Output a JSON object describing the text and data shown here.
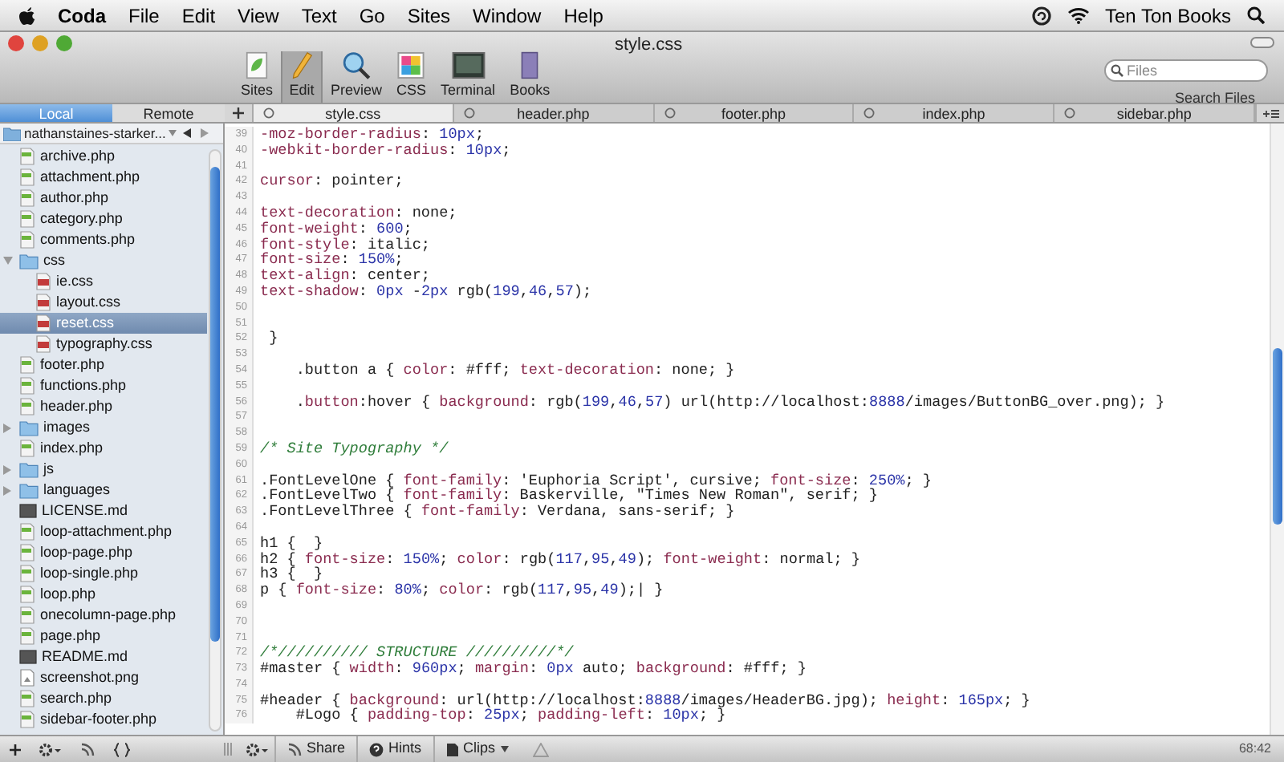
{
  "menu_bar": {
    "app": "Coda",
    "items": [
      "File",
      "Edit",
      "View",
      "Text",
      "Go",
      "Sites",
      "Window",
      "Help"
    ],
    "user": "Ten Ton Books"
  },
  "window": {
    "title": "style.css"
  },
  "toolbar": {
    "buttons": [
      {
        "label": "Sites",
        "kind": "sites",
        "selected": false
      },
      {
        "label": "Edit",
        "kind": "edit",
        "selected": true
      },
      {
        "label": "Preview",
        "kind": "preview",
        "selected": false
      },
      {
        "label": "CSS",
        "kind": "css",
        "selected": false
      },
      {
        "label": "Terminal",
        "kind": "terminal",
        "selected": false
      },
      {
        "label": "Books",
        "kind": "books",
        "selected": false
      }
    ],
    "search": {
      "placeholder": "Files",
      "label": "Search Files"
    }
  },
  "sidebar": {
    "tabs": [
      {
        "label": "Local",
        "selected": true
      },
      {
        "label": "Remote",
        "selected": false
      }
    ],
    "site": "nathanstaines-starker...",
    "items": [
      {
        "name": "archive.php",
        "kind": "php",
        "selected": false
      },
      {
        "name": "attachment.php",
        "kind": "php",
        "selected": false
      },
      {
        "name": "author.php",
        "kind": "php",
        "selected": false
      },
      {
        "name": "category.php",
        "kind": "php",
        "selected": false
      },
      {
        "name": "comments.php",
        "kind": "php",
        "selected": false
      },
      {
        "name": "css",
        "kind": "folder",
        "expanded": true,
        "selected": false,
        "children": [
          {
            "name": "ie.css",
            "kind": "css",
            "selected": false
          },
          {
            "name": "layout.css",
            "kind": "css",
            "selected": false
          },
          {
            "name": "reset.css",
            "kind": "css",
            "selected": true
          },
          {
            "name": "typography.css",
            "kind": "css",
            "selected": false
          }
        ]
      },
      {
        "name": "footer.php",
        "kind": "php",
        "selected": false
      },
      {
        "name": "functions.php",
        "kind": "php",
        "selected": false
      },
      {
        "name": "header.php",
        "kind": "php",
        "selected": false
      },
      {
        "name": "images",
        "kind": "folder",
        "expanded": false,
        "selected": false
      },
      {
        "name": "index.php",
        "kind": "php",
        "selected": false
      },
      {
        "name": "js",
        "kind": "folder",
        "expanded": false,
        "selected": false
      },
      {
        "name": "languages",
        "kind": "folder",
        "expanded": false,
        "selected": false
      },
      {
        "name": "LICENSE.md",
        "kind": "md",
        "selected": false
      },
      {
        "name": "loop-attachment.php",
        "kind": "php",
        "selected": false
      },
      {
        "name": "loop-page.php",
        "kind": "php",
        "selected": false
      },
      {
        "name": "loop-single.php",
        "kind": "php",
        "selected": false
      },
      {
        "name": "loop.php",
        "kind": "php",
        "selected": false
      },
      {
        "name": "onecolumn-page.php",
        "kind": "php",
        "selected": false
      },
      {
        "name": "page.php",
        "kind": "php",
        "selected": false
      },
      {
        "name": "README.md",
        "kind": "md",
        "selected": false
      },
      {
        "name": "screenshot.png",
        "kind": "png",
        "selected": false
      },
      {
        "name": "search.php",
        "kind": "php",
        "selected": false
      },
      {
        "name": "sidebar-footer.php",
        "kind": "php",
        "selected": false
      }
    ]
  },
  "tabs": [
    {
      "label": "style.css",
      "selected": true
    },
    {
      "label": "header.php",
      "selected": false
    },
    {
      "label": "footer.php",
      "selected": false
    },
    {
      "label": "index.php",
      "selected": false
    },
    {
      "label": "sidebar.php",
      "selected": false
    }
  ],
  "editor": {
    "lines": [
      {
        "num": "39",
        "text": "-moz-border-radius: 10px;"
      },
      {
        "num": "40",
        "text": "-webkit-border-radius: 10px;"
      },
      {
        "num": "41"
      },
      {
        "num": "42",
        "text": "cursor: pointer;"
      },
      {
        "num": "43"
      },
      {
        "num": "44",
        "text": "text-decoration: none;"
      },
      {
        "num": "45",
        "text": "font-weight: 600;"
      },
      {
        "num": "46",
        "text": "font-style: italic;"
      },
      {
        "num": "47",
        "text": "font-size: 150%;"
      },
      {
        "num": "48",
        "text": "text-align: center;"
      },
      {
        "num": "49",
        "text": "text-shadow: 0px -2px rgb(199,46,57);"
      },
      {
        "num": "50"
      },
      {
        "num": "51"
      },
      {
        "num": "52",
        "text": " }"
      },
      {
        "num": "53"
      },
      {
        "num": "54",
        "text": "    .button a { color: #fff; text-decoration: none; }"
      },
      {
        "num": "55"
      },
      {
        "num": "56",
        "text": "    .button:hover { background: rgb(199,46,57) url(http://localhost:8888/images/ButtonBG_over.png); }"
      },
      {
        "num": "57"
      },
      {
        "num": "58"
      },
      {
        "num": "59",
        "text": "/* Site Typography */"
      },
      {
        "num": "60"
      },
      {
        "num": "61",
        "text": ".FontLevelOne { font-family: 'Euphoria Script', cursive; font-size: 250%; }"
      },
      {
        "num": "62",
        "text": ".FontLevelTwo { font-family: Baskerville, \"Times New Roman\", serif; }"
      },
      {
        "num": "63",
        "text": ".FontLevelThree { font-family: Verdana, sans-serif; }"
      },
      {
        "num": "64"
      },
      {
        "num": "65",
        "text": "h1 {  }"
      },
      {
        "num": "66",
        "text": "h2 { font-size: 150%; color: rgb(117,95,49); font-weight: normal; }"
      },
      {
        "num": "67",
        "text": "h3 {  }"
      },
      {
        "num": "68",
        "text": "p { font-size: 80%; color: rgb(117,95,49);| }"
      },
      {
        "num": "69"
      },
      {
        "num": "70"
      },
      {
        "num": "71"
      },
      {
        "num": "72",
        "text": "/*////////// STRUCTURE //////////*/"
      },
      {
        "num": "73",
        "text": "#master { width: 960px; margin: 0px auto; background: #fff; }"
      },
      {
        "num": "74"
      },
      {
        "num": "75",
        "text": "#header { background: url(http://localhost:8888/images/HeaderBG.jpg); height: 165px; }"
      },
      {
        "num": "76",
        "text": "    #Logo { padding-top: 25px; padding-left: 10px; }"
      }
    ]
  },
  "status_bar": {
    "buttons": [
      "Share",
      "Hints",
      "Clips"
    ],
    "position": "68:42"
  }
}
